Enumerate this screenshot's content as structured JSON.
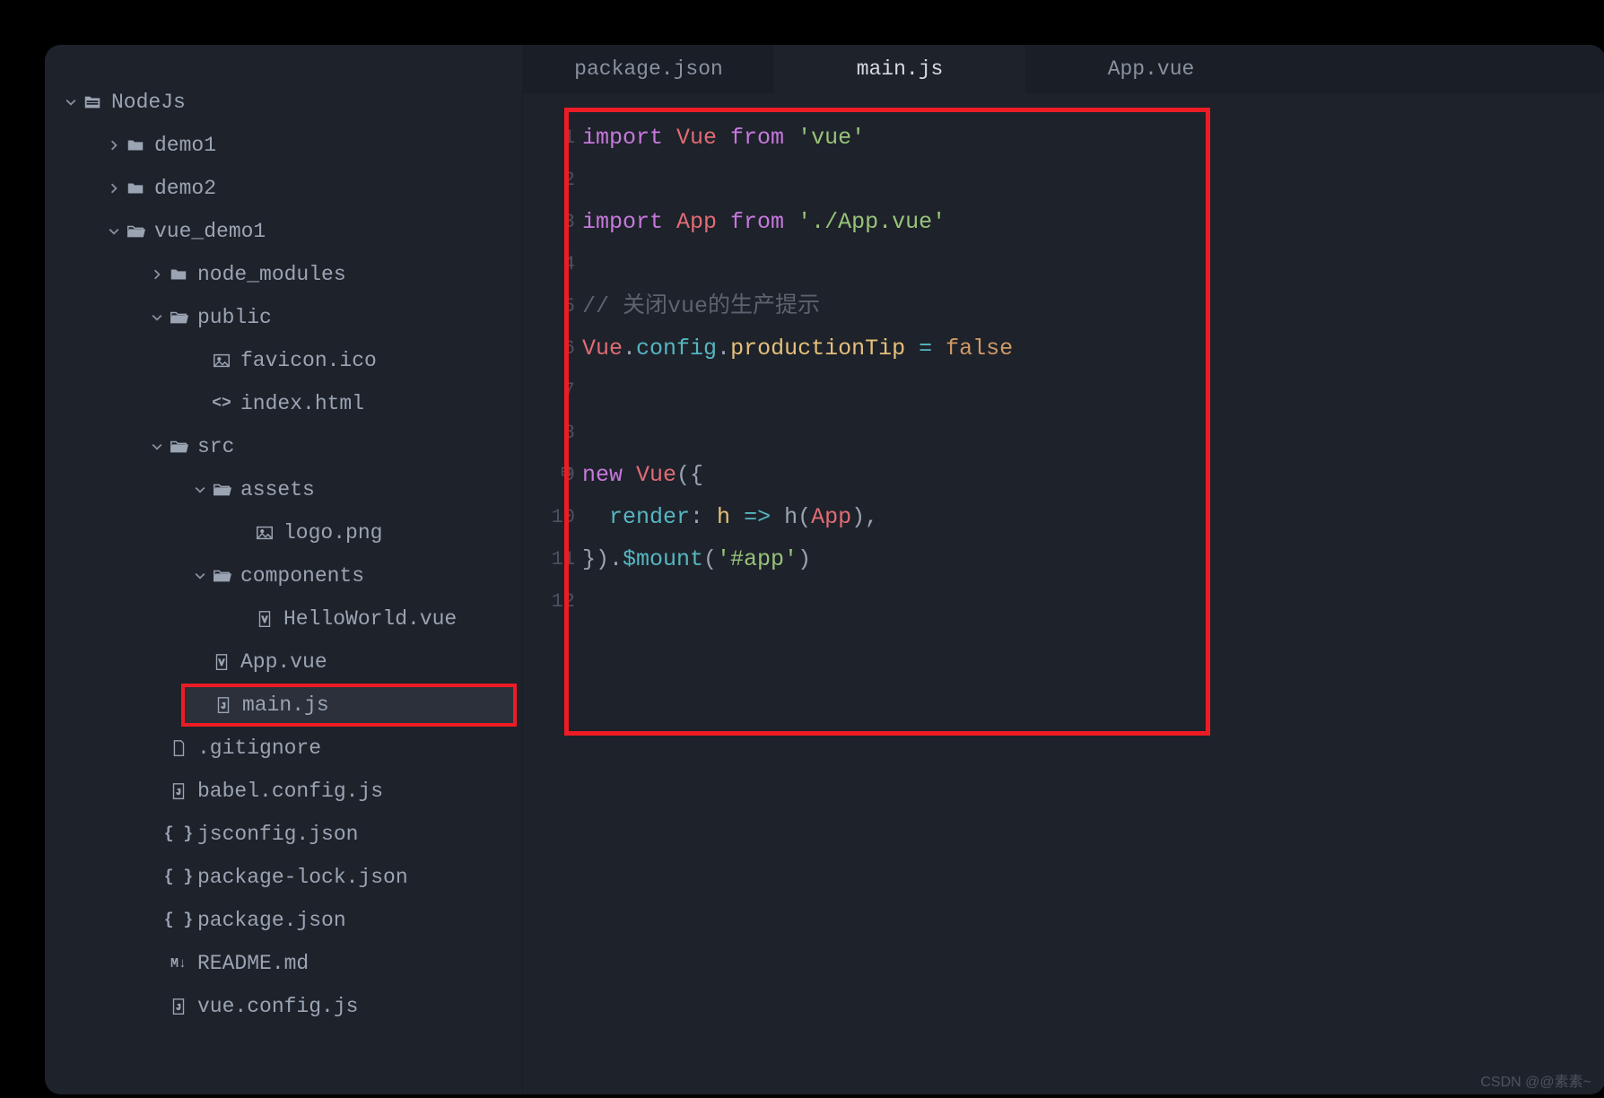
{
  "tree": {
    "root": "NodeJs",
    "items": [
      {
        "depth": 0,
        "chev": "down",
        "icon": "folder-root",
        "label": "NodeJs"
      },
      {
        "depth": 1,
        "chev": "right",
        "icon": "folder",
        "label": "demo1"
      },
      {
        "depth": 1,
        "chev": "right",
        "icon": "folder",
        "label": "demo2"
      },
      {
        "depth": 1,
        "chev": "down",
        "icon": "folder-open",
        "label": "vue_demo1"
      },
      {
        "depth": 2,
        "chev": "right",
        "icon": "folder",
        "label": "node_modules"
      },
      {
        "depth": 2,
        "chev": "down",
        "icon": "folder-open",
        "label": "public"
      },
      {
        "depth": 3,
        "chev": "blank",
        "icon": "image",
        "label": "favicon.ico"
      },
      {
        "depth": 3,
        "chev": "blank",
        "icon": "code",
        "label": "index.html"
      },
      {
        "depth": 2,
        "chev": "down",
        "icon": "folder-open",
        "label": "src"
      },
      {
        "depth": 3,
        "chev": "down",
        "icon": "folder-open",
        "label": "assets"
      },
      {
        "depth": 4,
        "chev": "blank",
        "icon": "image",
        "label": "logo.png"
      },
      {
        "depth": 3,
        "chev": "down",
        "icon": "folder-open",
        "label": "components"
      },
      {
        "depth": 4,
        "chev": "blank",
        "icon": "vue",
        "label": "HelloWorld.vue"
      },
      {
        "depth": 3,
        "chev": "blank",
        "icon": "vue",
        "label": "App.vue"
      },
      {
        "depth": 3,
        "chev": "blank",
        "icon": "js",
        "label": "main.js",
        "selected": true,
        "highlight": true
      },
      {
        "depth": 2,
        "chev": "blank",
        "icon": "file",
        "label": ".gitignore"
      },
      {
        "depth": 2,
        "chev": "blank",
        "icon": "js",
        "label": "babel.config.js"
      },
      {
        "depth": 2,
        "chev": "blank",
        "icon": "json",
        "label": "jsconfig.json"
      },
      {
        "depth": 2,
        "chev": "blank",
        "icon": "json",
        "label": "package-lock.json"
      },
      {
        "depth": 2,
        "chev": "blank",
        "icon": "json",
        "label": "package.json"
      },
      {
        "depth": 2,
        "chev": "blank",
        "icon": "md",
        "label": "README.md"
      },
      {
        "depth": 2,
        "chev": "blank",
        "icon": "js",
        "label": "vue.config.js"
      }
    ]
  },
  "tabs": [
    {
      "label": "package.json",
      "active": false
    },
    {
      "label": "main.js",
      "active": true
    },
    {
      "label": "App.vue",
      "active": false
    }
  ],
  "code": {
    "lines": [
      {
        "n": 1,
        "tokens": [
          {
            "t": "import ",
            "c": "kw"
          },
          {
            "t": "Vue ",
            "c": "cls"
          },
          {
            "t": "from ",
            "c": "kw"
          },
          {
            "t": "'vue'",
            "c": "str"
          }
        ]
      },
      {
        "n": 2,
        "tokens": []
      },
      {
        "n": 3,
        "tokens": [
          {
            "t": "import ",
            "c": "kw"
          },
          {
            "t": "App ",
            "c": "cls"
          },
          {
            "t": "from ",
            "c": "kw"
          },
          {
            "t": "'./App.vue'",
            "c": "str"
          }
        ]
      },
      {
        "n": 4,
        "tokens": []
      },
      {
        "n": 5,
        "tokens": [
          {
            "t": "// 关闭vue的生产提示",
            "c": "cm"
          }
        ]
      },
      {
        "n": 6,
        "tokens": [
          {
            "t": "Vue",
            "c": "cls"
          },
          {
            "t": ".",
            "c": ""
          },
          {
            "t": "config",
            "c": "id"
          },
          {
            "t": ".",
            "c": ""
          },
          {
            "t": "productionTip",
            "c": "prop"
          },
          {
            "t": " = ",
            "c": "op"
          },
          {
            "t": "false",
            "c": "num"
          }
        ]
      },
      {
        "n": 7,
        "tokens": []
      },
      {
        "n": 8,
        "tokens": []
      },
      {
        "n": 9,
        "tokens": [
          {
            "t": "new ",
            "c": "kw"
          },
          {
            "t": "Vue",
            "c": "cls"
          },
          {
            "t": "({",
            "c": ""
          }
        ]
      },
      {
        "n": 10,
        "tokens": [
          {
            "t": "  ",
            "c": ""
          },
          {
            "t": "render",
            "c": "id"
          },
          {
            "t": ": ",
            "c": ""
          },
          {
            "t": "h ",
            "c": "prop"
          },
          {
            "t": "=>",
            "c": "op"
          },
          {
            "t": " h(",
            "c": ""
          },
          {
            "t": "App",
            "c": "cls"
          },
          {
            "t": "),",
            "c": ""
          }
        ]
      },
      {
        "n": 11,
        "tokens": [
          {
            "t": "}).",
            "c": ""
          },
          {
            "t": "$mount",
            "c": "fn"
          },
          {
            "t": "(",
            "c": ""
          },
          {
            "t": "'#app'",
            "c": "str"
          },
          {
            "t": ")",
            "c": ""
          }
        ]
      },
      {
        "n": 12,
        "tokens": []
      }
    ]
  },
  "watermark": "CSDN @@素素~"
}
